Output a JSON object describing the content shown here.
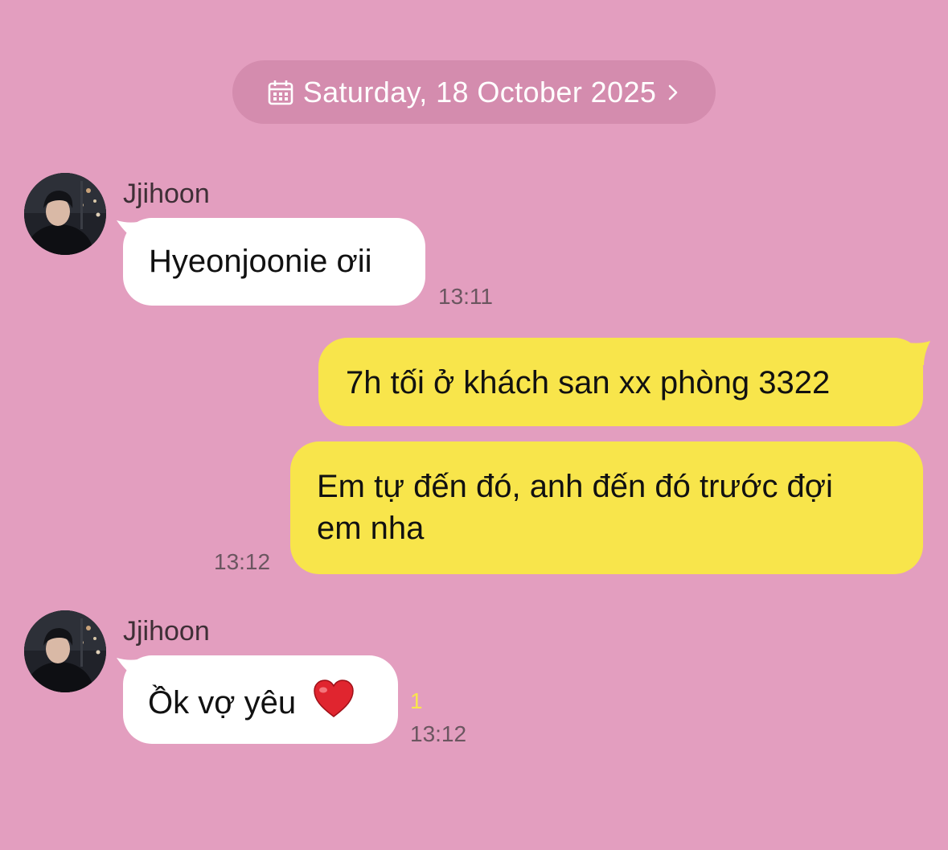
{
  "date_bar": {
    "label": "Saturday, 18 October 2025",
    "icon": "calendar-icon",
    "chevron": "chevron-right-icon"
  },
  "messages": [
    {
      "sender": "Jjihoon",
      "direction": "incoming",
      "text": "Hyeonjoonie ơii",
      "time": "13:11"
    },
    {
      "direction": "outgoing",
      "text": "7h tối ở khách san xx phòng 3322"
    },
    {
      "direction": "outgoing",
      "text_line1": "Em tự đến đó, anh đến đó trước đợi",
      "text_line2": "em nha",
      "time": "13:12"
    },
    {
      "sender": "Jjihoon",
      "direction": "incoming",
      "text": "Ồk vợ yêu",
      "emoji": "heart-emoji",
      "unread_count": "1",
      "time": "13:12"
    }
  ],
  "colors": {
    "background": "#e39ebf",
    "date_pill": "#d48cae",
    "incoming_bubble": "#ffffff",
    "outgoing_bubble": "#f8e54b",
    "unread_count": "#f8e54b"
  }
}
